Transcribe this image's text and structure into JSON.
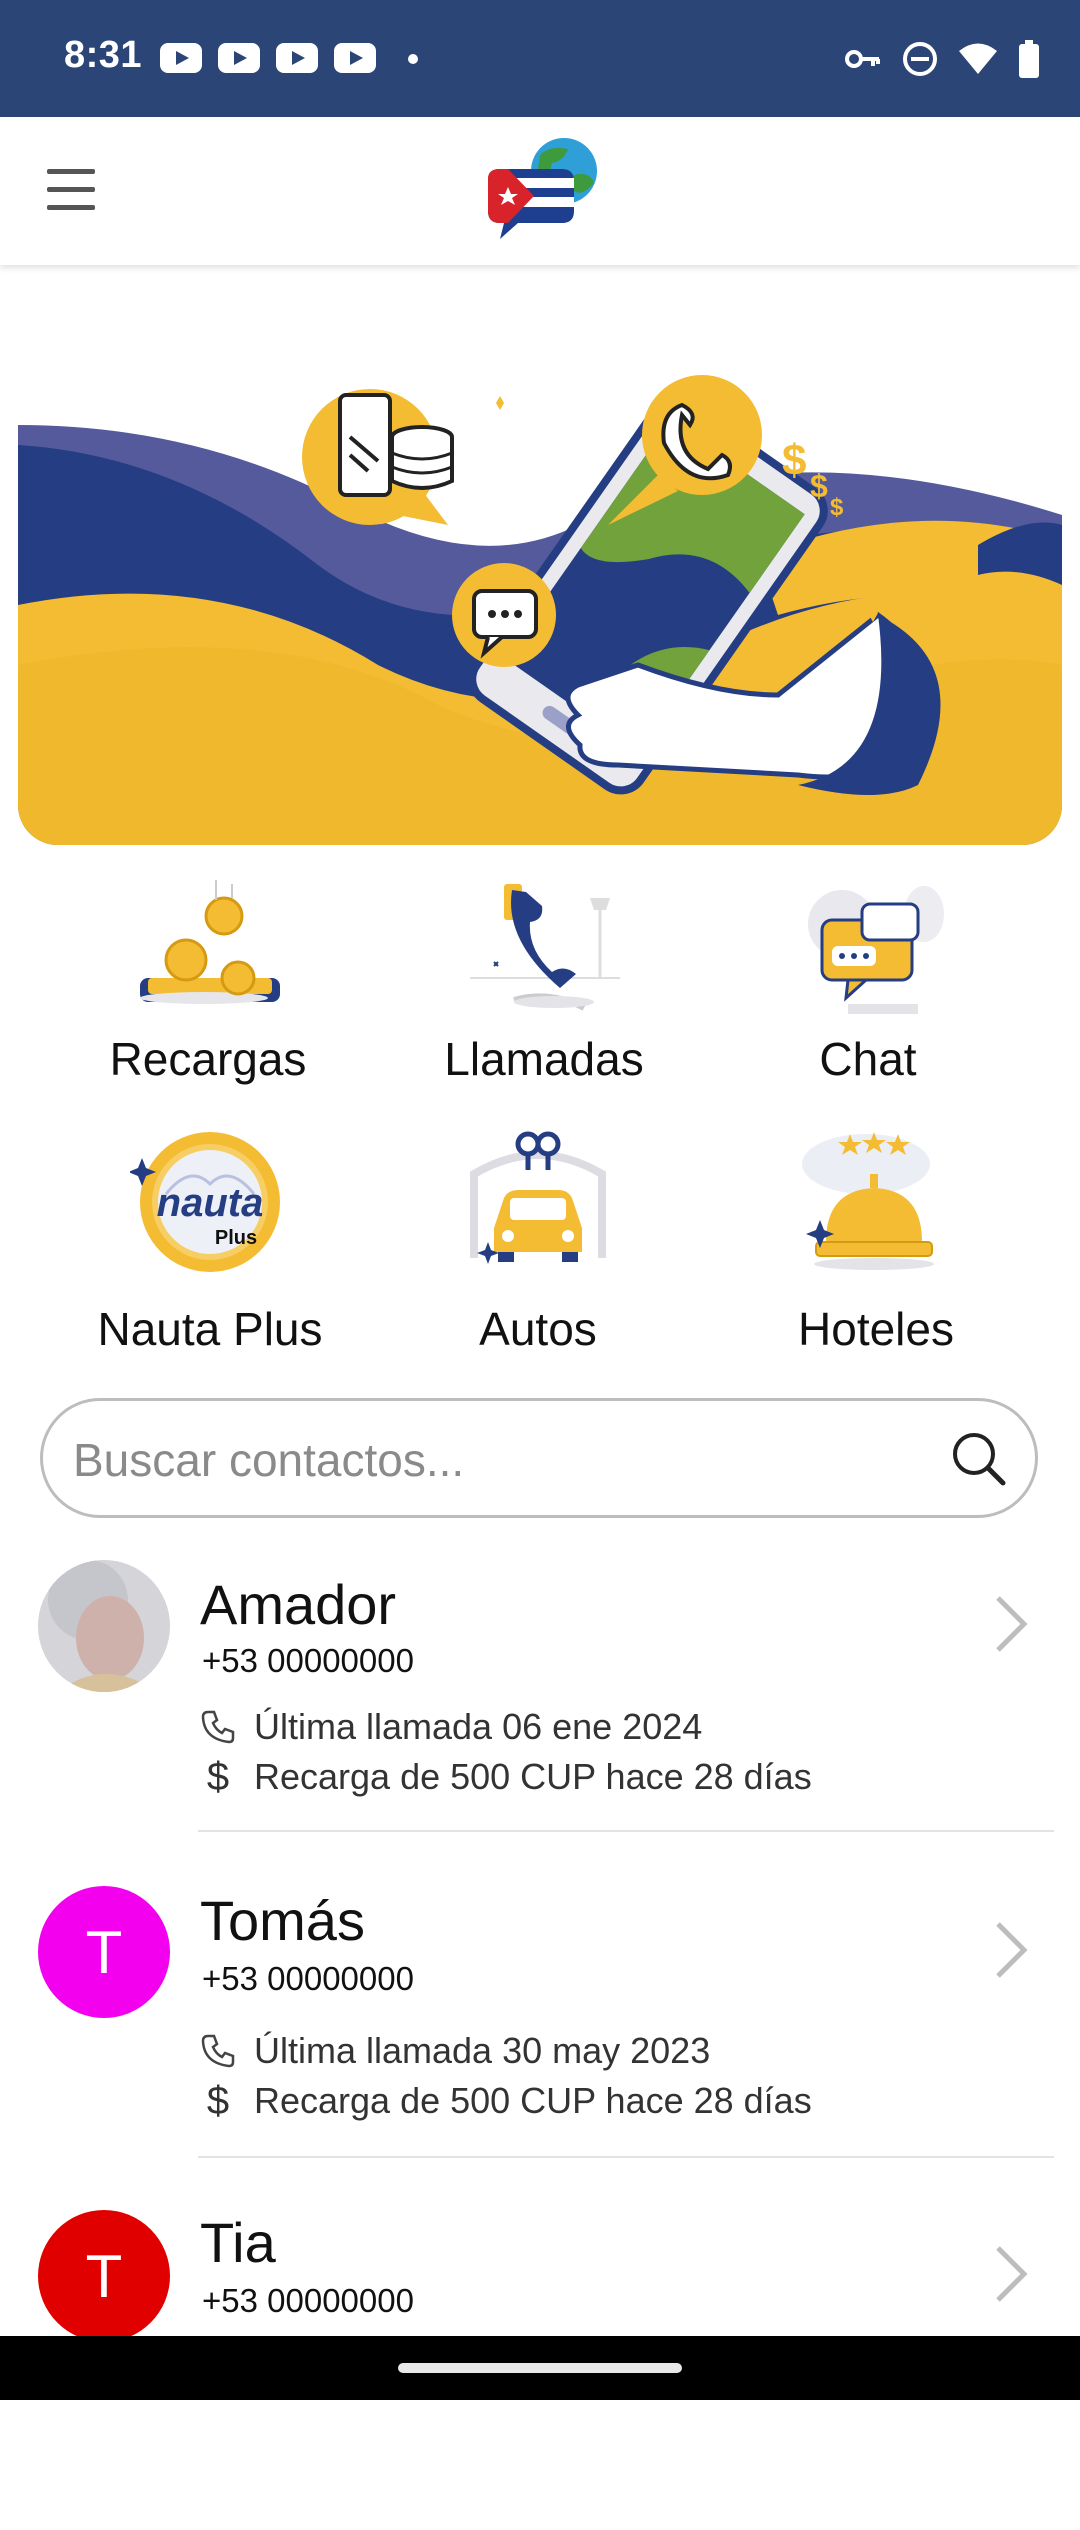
{
  "status_bar": {
    "time": "8:31",
    "notification_icons": [
      "youtube-icon",
      "youtube-icon",
      "youtube-icon",
      "youtube-icon",
      "dot-icon"
    ],
    "system_icons": [
      "vpn-key-icon",
      "do-not-disturb-icon",
      "wifi-icon",
      "battery-icon"
    ],
    "background": "#2b4676"
  },
  "app_bar": {
    "menu_icon": "hamburger-menu-icon",
    "logo": "cuba-flag-chat-logo"
  },
  "banner": {
    "illustration": "phone-calls-recharge-hero",
    "colors": {
      "blue": "#253d82",
      "yellow": "#f3bc33",
      "purple": "#545a9b"
    }
  },
  "services": [
    {
      "label": "Recargas",
      "icon": "coins-recharge-icon"
    },
    {
      "label": "Llamadas",
      "icon": "phone-call-icon"
    },
    {
      "label": "Chat",
      "icon": "chat-bubbles-icon"
    },
    {
      "label": "Nauta Plus",
      "icon": "nauta-plus-icon",
      "badge_text": "nauta",
      "badge_sub": "Plus"
    },
    {
      "label": "Autos",
      "icon": "car-keys-icon"
    },
    {
      "label": "Hoteles",
      "icon": "hotel-bell-icon"
    }
  ],
  "search": {
    "placeholder": "Buscar contactos...",
    "value": ""
  },
  "contacts": [
    {
      "name": "Amador",
      "phone": "+53 00000000",
      "last_call": "Última llamada 06 ene 2024",
      "recharge": "Recarga de 500 CUP hace 28 días",
      "avatar_type": "photo"
    },
    {
      "name": "Tomás",
      "phone": "+53 00000000",
      "last_call": "Última llamada 30 may 2023",
      "recharge": "Recarga de 500 CUP hace 28 días",
      "avatar_type": "letter",
      "avatar_letter": "T",
      "avatar_color": "#f300ef"
    },
    {
      "name": "Tia",
      "phone": "+53 00000000",
      "avatar_type": "letter",
      "avatar_letter": "T",
      "avatar_color": "#e10000"
    }
  ],
  "dollar_glyph": "$"
}
